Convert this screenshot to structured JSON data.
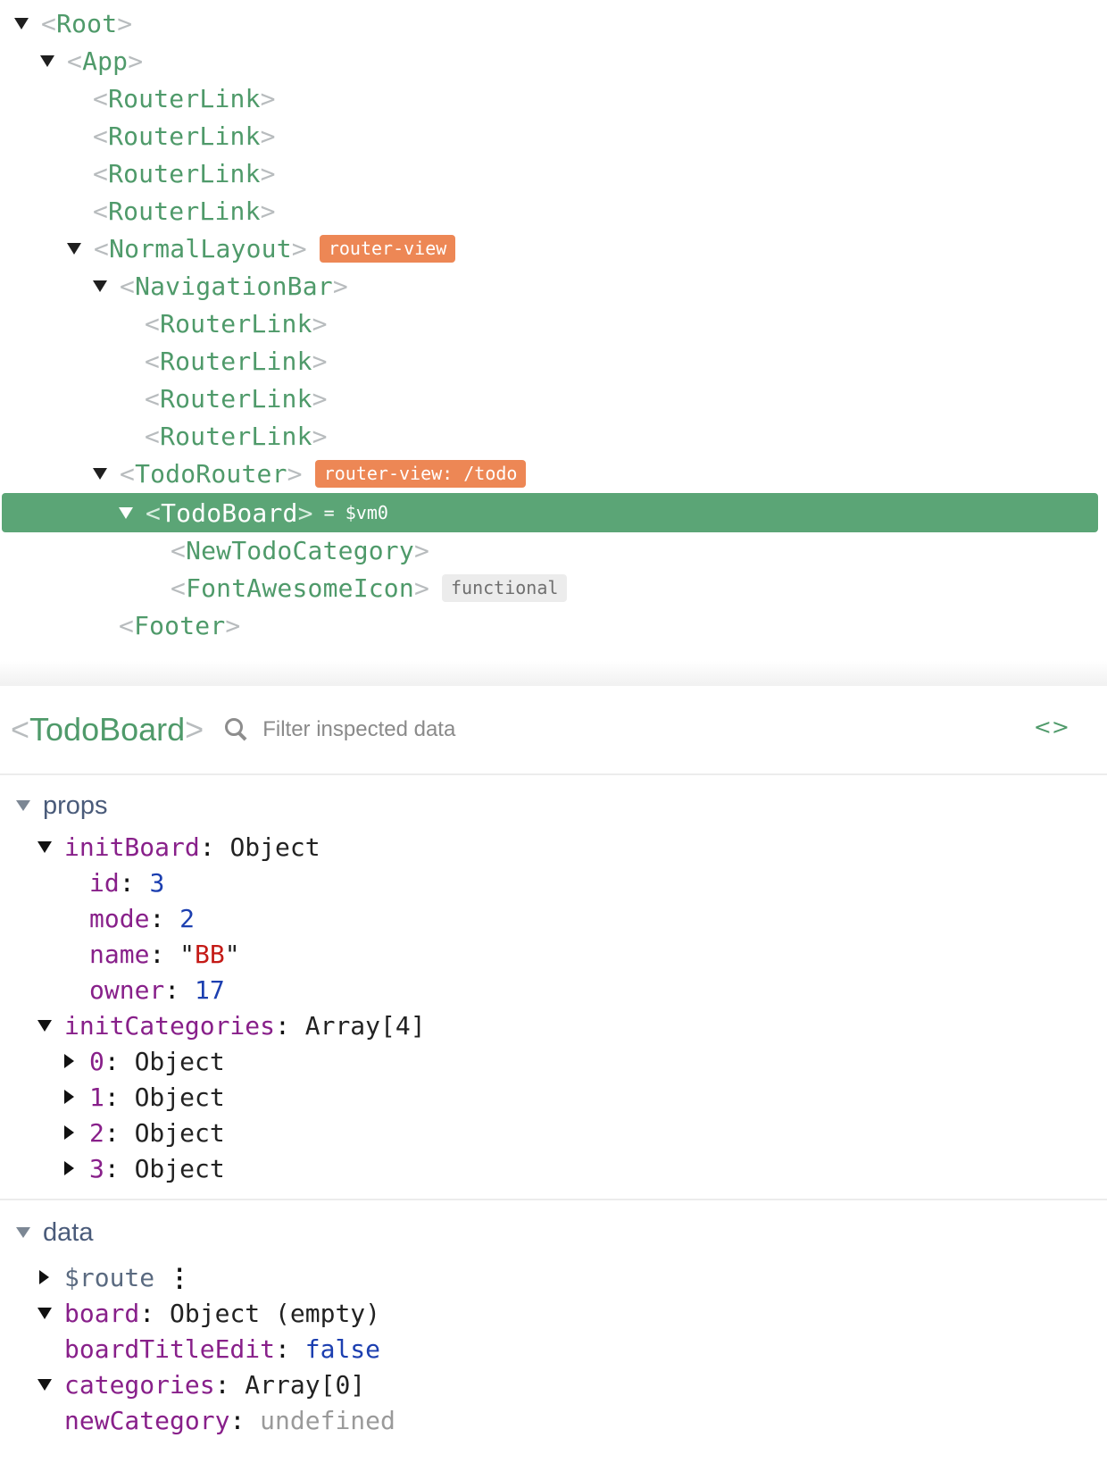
{
  "tree": {
    "rows": [
      {
        "name": "Root"
      },
      {
        "name": "App"
      },
      {
        "name": "RouterLink"
      },
      {
        "name": "RouterLink"
      },
      {
        "name": "RouterLink"
      },
      {
        "name": "RouterLink"
      },
      {
        "name": "NormalLayout",
        "badge": "router-view"
      },
      {
        "name": "NavigationBar"
      },
      {
        "name": "RouterLink"
      },
      {
        "name": "RouterLink"
      },
      {
        "name": "RouterLink"
      },
      {
        "name": "RouterLink"
      },
      {
        "name": "TodoRouter",
        "badge": "router-view: /todo"
      },
      {
        "name": "TodoBoard",
        "vm": "= $vm0",
        "selected": true
      },
      {
        "name": "NewTodoCategory"
      },
      {
        "name": "FontAwesomeIcon",
        "badge": "functional"
      },
      {
        "name": "Footer"
      }
    ]
  },
  "inspector": {
    "component": "TodoBoard",
    "filter_placeholder": "Filter inspected data",
    "code_icon": "<>",
    "props": {
      "label": "props",
      "initBoard": {
        "key": "initBoard",
        "type": "Object",
        "fields": [
          {
            "key": "id",
            "value": "3"
          },
          {
            "key": "mode",
            "value": "2"
          },
          {
            "key": "name",
            "value": "BB"
          },
          {
            "key": "owner",
            "value": "17"
          }
        ]
      },
      "initCategories": {
        "key": "initCategories",
        "type": "Array[4]",
        "items": [
          {
            "key": "0",
            "type": "Object"
          },
          {
            "key": "1",
            "type": "Object"
          },
          {
            "key": "2",
            "type": "Object"
          },
          {
            "key": "3",
            "type": "Object"
          }
        ]
      }
    },
    "data": {
      "label": "data",
      "route": {
        "key": "$route"
      },
      "board": {
        "key": "board",
        "type": "Object (empty)"
      },
      "boardTitleEdit": {
        "key": "boardTitleEdit",
        "value": "false"
      },
      "categories": {
        "key": "categories",
        "type": "Array[0]"
      },
      "newCategory": {
        "key": "newCategory",
        "value": "undefined"
      }
    }
  },
  "colors": {
    "component_green": "#4f9a6a",
    "selected_row": "#5ba576",
    "badge_orange": "#ed8755",
    "badge_grey": "#ececec",
    "key_purple": "#88208a",
    "number_blue": "#1c3fb0",
    "string_red": "#c41a16"
  }
}
